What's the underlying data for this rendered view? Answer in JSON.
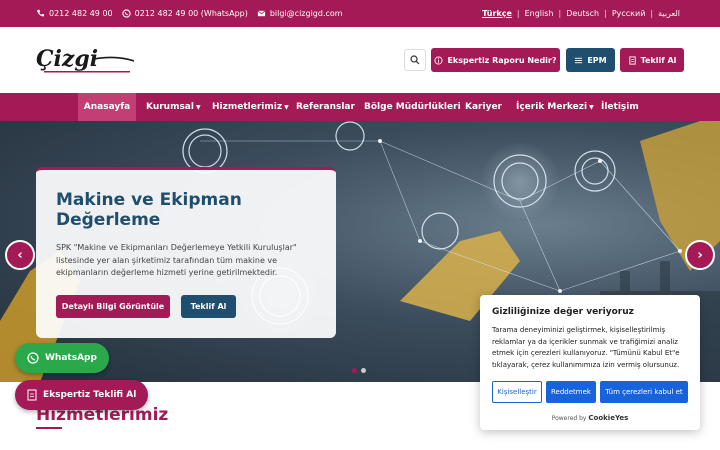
{
  "topbar": {
    "phone": "0212 482 49 00",
    "whatsapp": "0212 482 49 00 (WhatsApp)",
    "email": "bilgi@cizgigd.com",
    "languages": [
      "Türkçe",
      "English",
      "Deutsch",
      "Русский",
      "العربية"
    ]
  },
  "header": {
    "logo_text": "Çizgi",
    "ekspertiz_button": "Ekspertiz Raporu Nedir?",
    "epm_button": "EPM",
    "teklif_button": "Teklif Al"
  },
  "nav": {
    "items": [
      {
        "label": "Anasayfa"
      },
      {
        "label": "Kurumsal"
      },
      {
        "label": "Hizmetlerimiz"
      },
      {
        "label": "Referanslar"
      },
      {
        "label": "Bölge Müdürlükleri"
      },
      {
        "label": "Kariyer"
      },
      {
        "label": "İçerik Merkezi"
      },
      {
        "label": "İletişim"
      }
    ]
  },
  "hero": {
    "title": "Makine ve Ekipman Değerleme",
    "description": "SPK \"Makine ve Ekipmanları Değerlemeye Yetkili Kuruluşlar\" listesinde yer alan şirketimiz tarafından tüm makine ve ekipmanların değerleme hizmeti yerine getirilmektedir.",
    "detail_button": "Detaylı Bilgi Görüntüle",
    "offer_button": "Teklif Al",
    "prev": "‹",
    "next": "›"
  },
  "section": {
    "title": "Hizmetlerimiz"
  },
  "floating": {
    "whatsapp": "WhatsApp",
    "ekspertiz": "Ekspertiz Teklifi Al"
  },
  "cookie": {
    "title": "Gizliliğinize değer veriyoruz",
    "description": "Tarama deneyiminizi geliştirmek, kişiselleştirilmiş reklamlar ya da içerikler sunmak ve trafiğimizi analiz etmek için çerezleri kullanıyoruz. \"Tümünü Kabul Et\"e tıklayarak, çerez kullanımımıza izin vermiş olursunuz.",
    "customize": "Kişiselleştir",
    "reject": "Reddetmek",
    "accept": "Tüm çerezleri kabul et",
    "powered_by": "Powered by",
    "powered_brand": "CookieYes"
  },
  "colors": {
    "brand": "#a31a56",
    "secondary": "#1f4e6e",
    "whatsapp": "#2aa84a",
    "cookie_blue": "#1863dc"
  }
}
